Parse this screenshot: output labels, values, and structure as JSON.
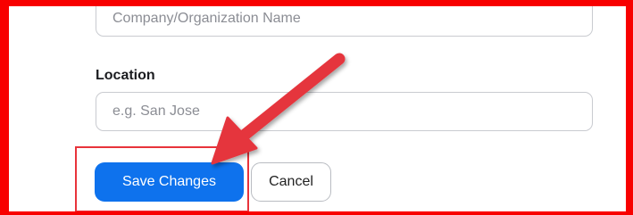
{
  "company": {
    "placeholder": "Company/Organization Name"
  },
  "location": {
    "label": "Location",
    "placeholder": "e.g. San Jose"
  },
  "actions": {
    "save_label": "Save Changes",
    "cancel_label": "Cancel"
  },
  "colors": {
    "frame": "#f80000",
    "highlight": "#e8333b",
    "arrow": "#e5353d",
    "save_button": "#0e72ed"
  }
}
